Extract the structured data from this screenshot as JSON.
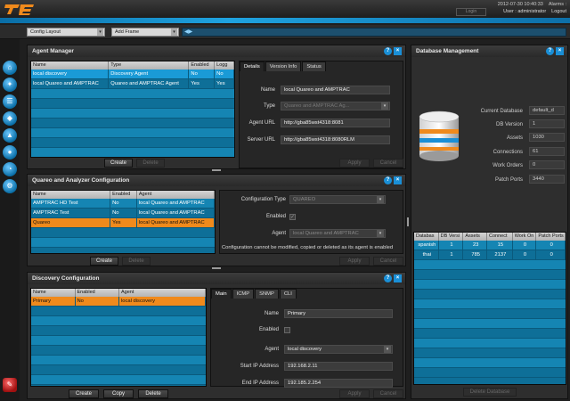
{
  "header": {
    "datetime": "2012-07-30 10:40:33",
    "alarms_label": "Alarms :",
    "login_label": "Login",
    "user_label": "User : administrator",
    "logout_label": "Logout"
  },
  "toolbar": {
    "config_layout": "Config Layout",
    "add_frame": "Add Frame"
  },
  "agent_manager": {
    "title": "Agent Manager",
    "columns": [
      "Name",
      "Type",
      "Enabled",
      "Logg"
    ],
    "rows": [
      [
        "local discovery",
        "Discovery Agent",
        "No",
        "No"
      ],
      [
        "local Quareo and AMPTRAC",
        "Quareo and AMPTRAC Agent",
        "Yes",
        "Yes"
      ]
    ],
    "create_label": "Create",
    "delete_label": "Delete",
    "tabs": [
      "Details",
      "Version Info",
      "Status"
    ],
    "fields": {
      "name_label": "Name",
      "name_value": "local Quareo and AMPTRAC",
      "type_label": "Type",
      "type_value": "Quareo and AMPTRAC Ag...",
      "url_label": "Agent URL",
      "url_value": "http://gba85wst4318:8081",
      "server_label": "Server URL",
      "server_value": "http://gba85wst4318:8080RLM"
    },
    "apply_label": "Apply",
    "cancel_label": "Cancel"
  },
  "quareo": {
    "title": "Quareo and Analyzer Configuration",
    "columns": [
      "Name",
      "Enabled",
      "Agent"
    ],
    "rows": [
      [
        "AMPTRAC HD Test",
        "No",
        "local Quareo and AMPTRAC"
      ],
      [
        "AMPTRAC Test",
        "No",
        "local Quareo and AMPTRAC"
      ],
      [
        "Quareo",
        "Yes",
        "local Quareo and AMPTRAC"
      ]
    ],
    "create_label": "Create",
    "delete_label": "Delete",
    "config_type_label": "Configuration Type",
    "config_type_value": "QUAREO",
    "enabled_label": "Enabled",
    "agent_label": "Agent",
    "agent_value": "local Quareo and AMPTRAC",
    "note": "Configuration cannot be modified, copied or deleted as its agent is enabled",
    "apply_label": "Apply",
    "cancel_label": "Cancel"
  },
  "discovery": {
    "title": "Discovery Configuration",
    "columns": [
      "Name",
      "Enabled",
      "Agent"
    ],
    "rows": [
      [
        "Primary",
        "No",
        "local discovery"
      ]
    ],
    "create_label": "Create",
    "copy_label": "Copy",
    "delete_label": "Delete",
    "tabs": [
      "Main",
      "ICMP",
      "SNMP",
      "CLI"
    ],
    "name_label": "Name",
    "name_value": "Primary",
    "enabled_label": "Enabled",
    "agent_label": "Agent",
    "agent_value": "local discovery",
    "start_label": "Start IP Address",
    "start_value": "192.168.2.11",
    "end_label": "End IP Address",
    "end_value": "192.185.2.254",
    "apply_label": "Apply",
    "cancel_label": "Cancel"
  },
  "database": {
    "title": "Database Management",
    "current_db_label": "Current Database",
    "current_db_value": "default_d",
    "db_version_label": "DB Version",
    "db_version_value": "1",
    "assets_label": "Assets",
    "assets_value": "1030",
    "connections_label": "Connections",
    "connections_value": "61",
    "work_orders_label": "Work Orders",
    "work_orders_value": "0",
    "patch_ports_label": "Patch Ports",
    "patch_ports_value": "3440",
    "columns": [
      "Databas",
      "DB Versi",
      "Assets",
      "Connect",
      "Work On",
      "Patch Ports"
    ],
    "rows": [
      [
        "spanish",
        "1",
        "23",
        "15",
        "0",
        "0"
      ],
      [
        "thai",
        "1",
        "785",
        "2137",
        "0",
        "0"
      ]
    ],
    "action_label": "Delete Database"
  },
  "colors": {
    "accent": "#1fa3e0",
    "selection": "#f08a1c",
    "table_bg": "#0e6f98"
  }
}
